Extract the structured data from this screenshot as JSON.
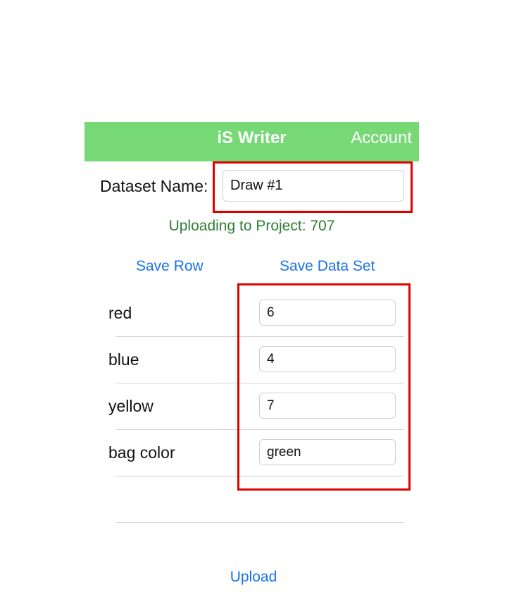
{
  "nav": {
    "title": "iS Writer",
    "account_label": "Account"
  },
  "dataset": {
    "label": "Dataset Name:",
    "value": "Draw #1"
  },
  "status": {
    "project_text": "Uploading to Project: 707"
  },
  "actions": {
    "save_row_label": "Save Row",
    "save_dataset_label": "Save Data Set",
    "upload_label": "Upload"
  },
  "rows": [
    {
      "label": "red",
      "value": "6"
    },
    {
      "label": "blue",
      "value": "4"
    },
    {
      "label": "yellow",
      "value": "7"
    },
    {
      "label": "bag color",
      "value": "green"
    }
  ],
  "colors": {
    "nav_background": "#76d975",
    "link_blue": "#1a73e8",
    "status_green": "#2e7d32",
    "highlight_red": "#e00000"
  }
}
